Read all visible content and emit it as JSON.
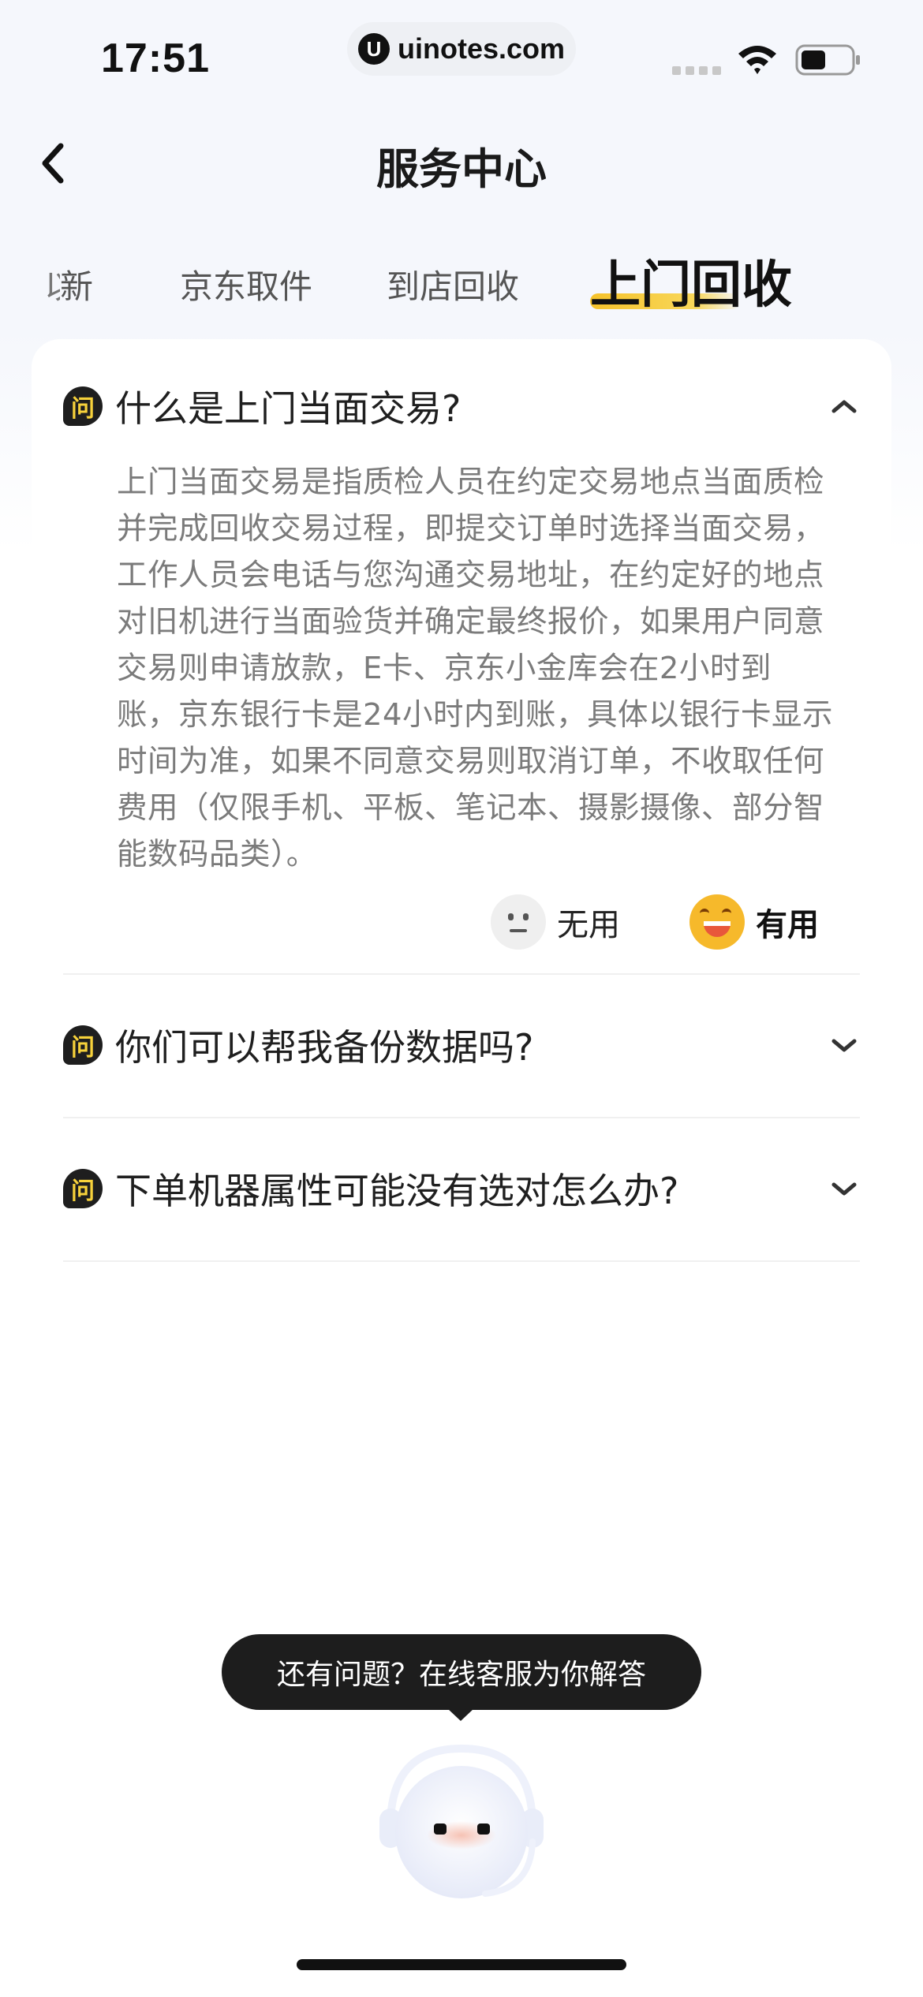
{
  "status_bar": {
    "time": "17:51",
    "url": "uinotes.com",
    "url_logo": "U"
  },
  "nav": {
    "back_icon": "chevron-left-icon",
    "title": "服务中心"
  },
  "tabs": [
    {
      "label": "以旧换新",
      "visible_label": "新",
      "active": false
    },
    {
      "label": "京东取件",
      "active": false
    },
    {
      "label": "到店回收",
      "active": false
    },
    {
      "label": "上门回收",
      "active": true
    }
  ],
  "faq": [
    {
      "badge": "问",
      "question": "什么是上门当面交易?",
      "expanded": true,
      "answer_lines": [
        "上门当面交易是指质检人员在约定交易地点当面质检",
        "并完成回收交易过程，即提交订单时选择当面交易，",
        "工作人员会电话与您沟通交易地址，在约定好的地点",
        "对旧机进行当面验货并确定最终报价，如果用户同意",
        "交易则申请放款，E卡、京东小金库会在2小时到",
        "账，京东银行卡是24小时内到账，具体以银行卡显示",
        "时间为准，如果不同意交易则取消订单，不收取任何",
        "费用（仅限手机、平板、笔记本、摄影摄像、部分智",
        "能数码品类）。"
      ],
      "feedback": {
        "useless_label": "无用",
        "useful_label": "有用"
      }
    },
    {
      "badge": "问",
      "question": "你们可以帮我备份数据吗?",
      "expanded": false
    },
    {
      "badge": "问",
      "question": "下单机器属性可能没有选对怎么办?",
      "expanded": false
    }
  ],
  "help": {
    "bubble_text": "还有问题？在线客服为你解答",
    "bot_icon": "customer-service-robot-icon"
  },
  "colors": {
    "accent": "#f5c22b",
    "dark": "#1d1d1d",
    "answer_text": "#7b7b7b"
  }
}
